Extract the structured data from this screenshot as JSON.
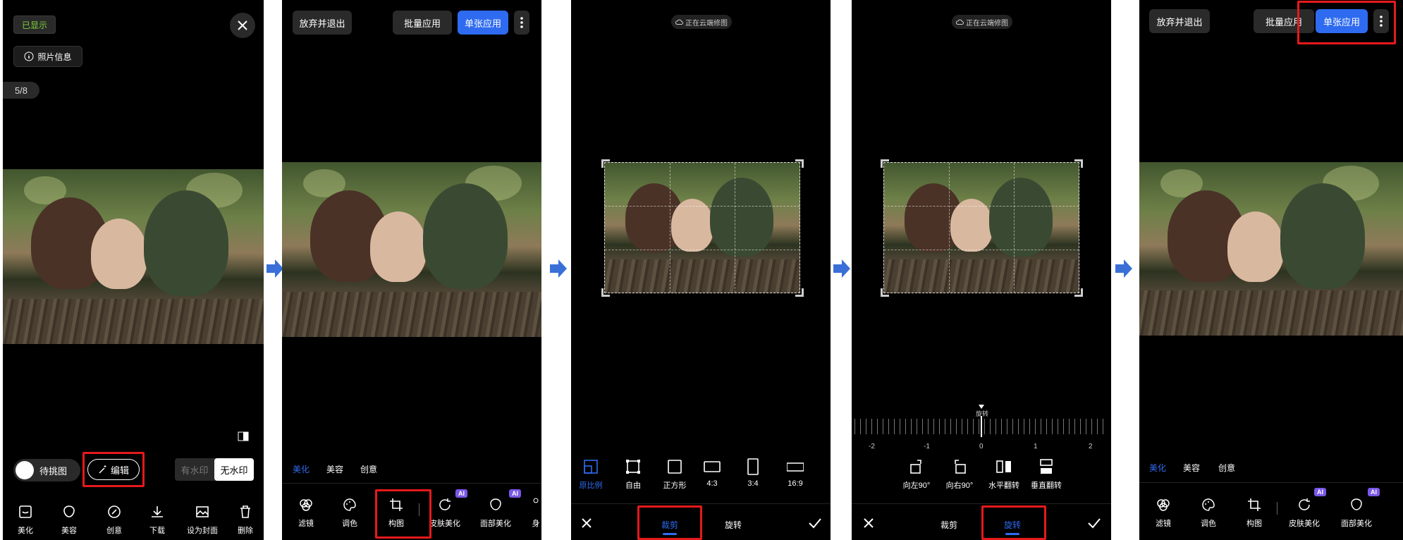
{
  "screen1": {
    "shown_badge": "已显示",
    "photo_info": "照片信息",
    "counter": "5/8",
    "pending_label": "待挑图",
    "edit_label": "编辑",
    "watermark_on": "有水印",
    "watermark_off": "无水印",
    "tools": [
      "美化",
      "美容",
      "创意",
      "下载",
      "设为封面",
      "删除"
    ]
  },
  "screen2": {
    "discard_label": "放弃并退出",
    "batch_label": "批量应用",
    "single_label": "单张应用",
    "categories": [
      "美化",
      "美容",
      "创意"
    ],
    "tools": [
      "滤镜",
      "调色",
      "构图",
      "皮肤美化",
      "面部美化",
      "身"
    ],
    "ai_badge": "AI"
  },
  "screen3": {
    "cloud_status": "正在云端修图",
    "ratios": [
      "原比例",
      "自由",
      "正方形",
      "4:3",
      "3:4",
      "16:9"
    ],
    "tab_crop": "裁剪",
    "tab_rotate": "旋转"
  },
  "screen4": {
    "cloud_status": "正在云端修图",
    "dial_label": "旋转",
    "ticks": [
      "-2",
      "-1",
      "0",
      "1",
      "2"
    ],
    "actions": [
      "向左90°",
      "向右90°",
      "水平翻转",
      "垂直翻转"
    ],
    "tab_crop": "裁剪",
    "tab_rotate": "旋转"
  },
  "screen5": {
    "discard_label": "放弃并退出",
    "batch_label": "批量应用",
    "single_label": "单张应用",
    "categories": [
      "美化",
      "美容",
      "创意"
    ],
    "tools": [
      "滤镜",
      "调色",
      "构图",
      "皮肤美化",
      "面部美化"
    ],
    "ai_badge": "AI"
  },
  "colors": {
    "accent": "#2f6bf0",
    "highlight_box": "#e5191c",
    "shown_badge_text": "#7fd13b",
    "ai_badge": "#7b57e8",
    "arrow": "#3a6fd8"
  }
}
